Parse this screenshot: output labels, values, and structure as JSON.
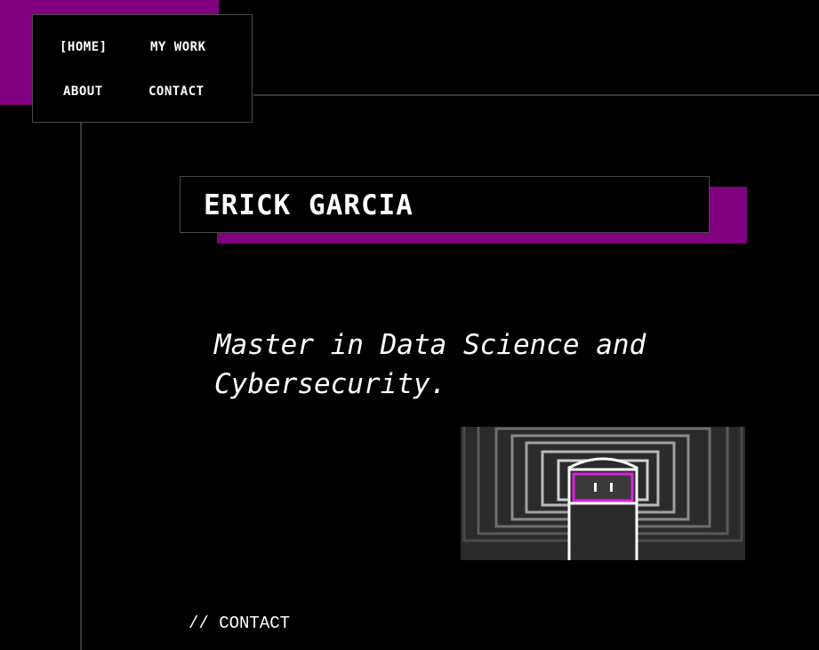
{
  "nav": {
    "home_label": "[HOME]",
    "work_label": "MY WORK",
    "about_label": "ABOUT",
    "contact_label": "CONTACT"
  },
  "hero": {
    "name": "ERICK GARCIA",
    "tagline": "Master in Data Science and Cybersecurity."
  },
  "footer": {
    "contact_link": "// CONTACT"
  },
  "colors": {
    "accent": "#800080",
    "background": "#000000",
    "text": "#ffffff",
    "line": "#3a3a3a",
    "illustration_highlight": "#e020e0"
  },
  "illustration": {
    "icon": "robot-in-tunnel-illustration"
  }
}
